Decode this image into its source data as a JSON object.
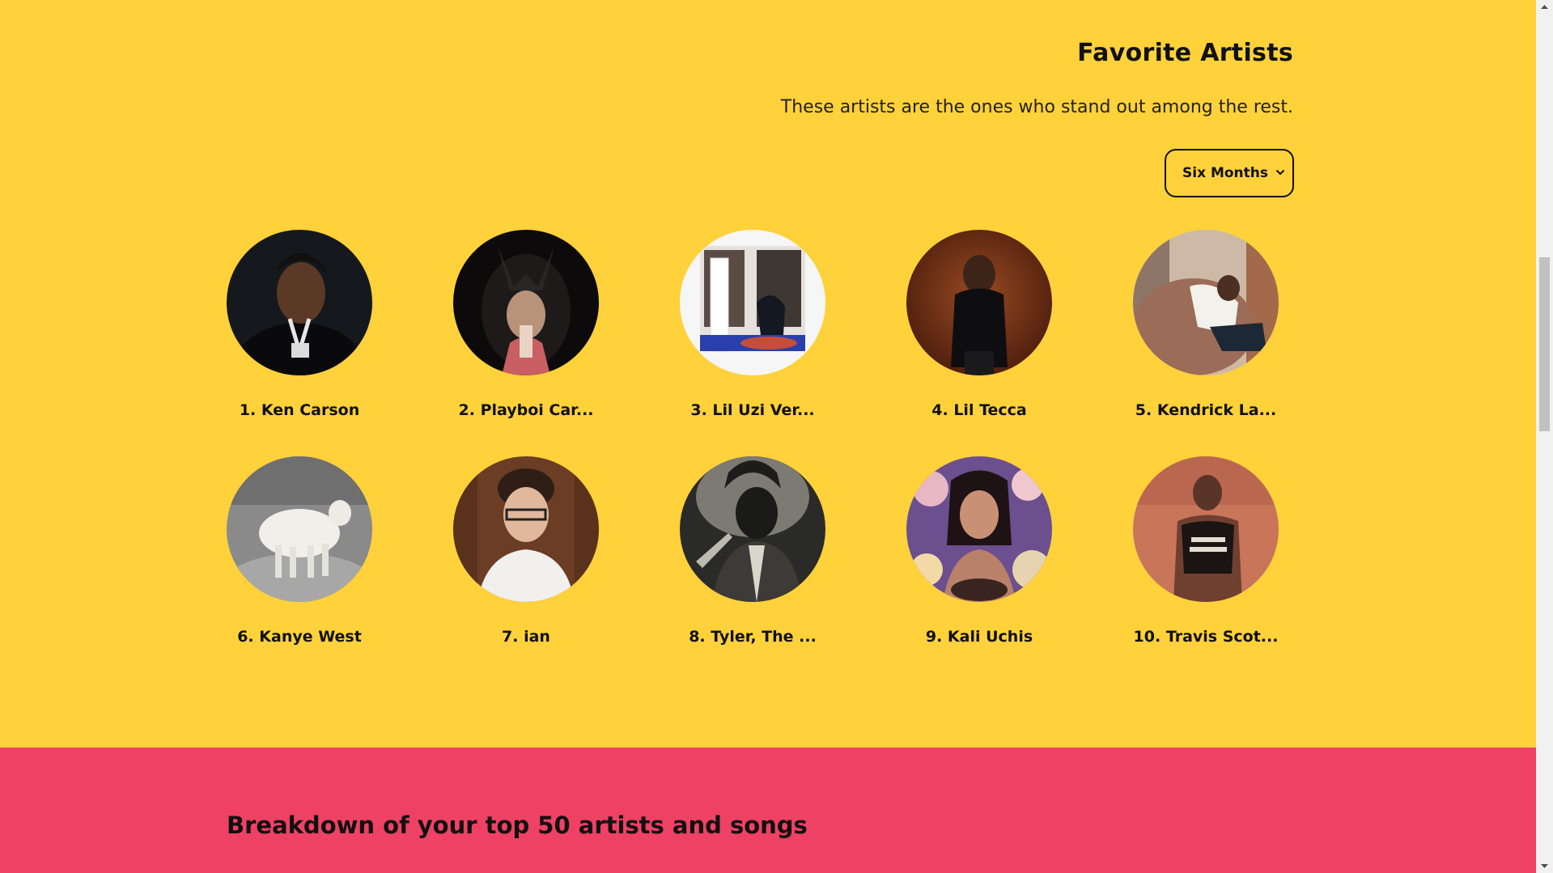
{
  "favorites": {
    "title": "Favorite Artists",
    "subtitle": "These artists are the ones who stand out among the rest.",
    "range_select": {
      "selected": "Six Months"
    },
    "artists": [
      {
        "rank": "1.",
        "name": "Ken Carson"
      },
      {
        "rank": "2.",
        "name": "Playboi Car..."
      },
      {
        "rank": "3.",
        "name": "Lil Uzi Ver..."
      },
      {
        "rank": "4.",
        "name": "Lil Tecca"
      },
      {
        "rank": "5.",
        "name": "Kendrick La..."
      },
      {
        "rank": "6.",
        "name": "Kanye West"
      },
      {
        "rank": "7.",
        "name": "ian"
      },
      {
        "rank": "8.",
        "name": "Tyler, The ..."
      },
      {
        "rank": "9.",
        "name": "Kali Uchis"
      },
      {
        "rank": "10.",
        "name": "Travis Scot..."
      }
    ]
  },
  "breakdown": {
    "title": "Breakdown of your top 50 artists and songs"
  },
  "colors": {
    "favorites_bg": "#FFD13B",
    "breakdown_bg": "#EF4164",
    "text": "#111111"
  }
}
